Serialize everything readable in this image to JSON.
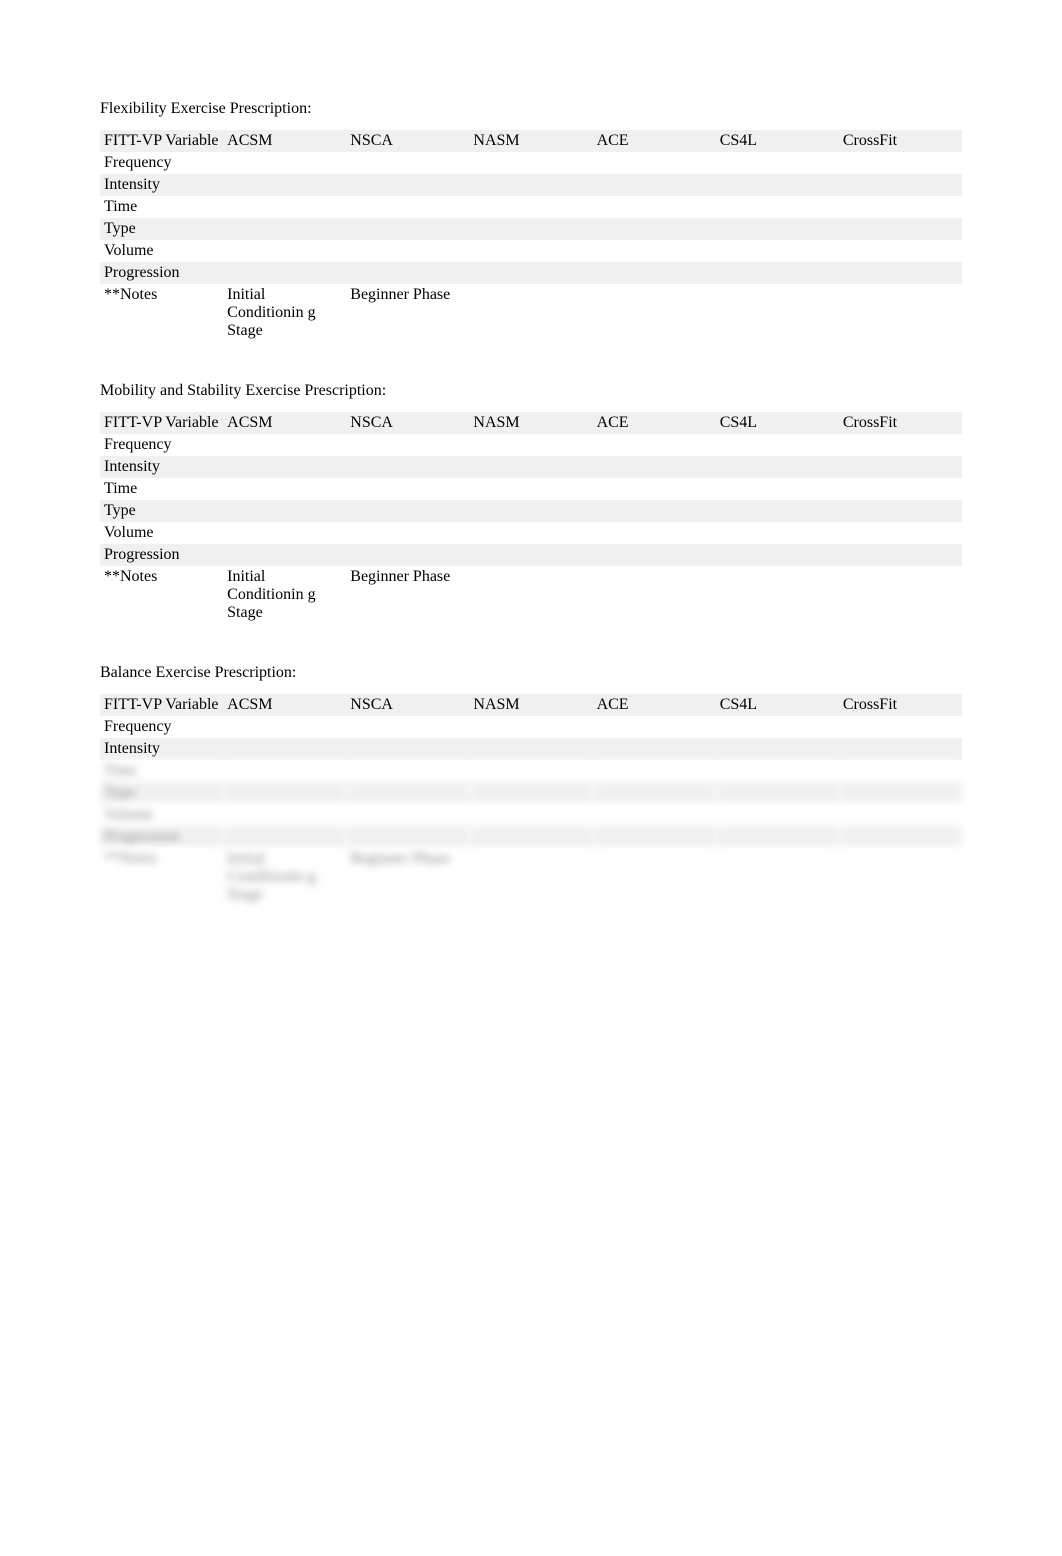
{
  "sections": [
    {
      "title": "Flexibility Exercise Prescription:",
      "columns": [
        "FITT-VP Variable",
        "ACSM",
        "NSCA",
        "NASM",
        "ACE",
        "CS4L",
        "CrossFit"
      ],
      "rows": [
        {
          "label": "Frequency",
          "values": [
            "",
            "",
            "",
            "",
            "",
            ""
          ]
        },
        {
          "label": "Intensity",
          "values": [
            "",
            "",
            "",
            "",
            "",
            ""
          ]
        },
        {
          "label": "Time",
          "values": [
            "",
            "",
            "",
            "",
            "",
            ""
          ]
        },
        {
          "label": "Type",
          "values": [
            "",
            "",
            "",
            "",
            "",
            ""
          ]
        },
        {
          "label": "Volume",
          "values": [
            "",
            "",
            "",
            "",
            "",
            ""
          ]
        },
        {
          "label": "Progression",
          "values": [
            "",
            "",
            "",
            "",
            "",
            ""
          ]
        },
        {
          "label": "**Notes",
          "values": [
            "Initial Conditionin g Stage",
            "Beginner Phase",
            "",
            "",
            "",
            ""
          ]
        }
      ],
      "blurred": false
    },
    {
      "title": "Mobility and Stability Exercise Prescription:",
      "columns": [
        "FITT-VP Variable",
        "ACSM",
        "NSCA",
        "NASM",
        "ACE",
        "CS4L",
        "CrossFit"
      ],
      "rows": [
        {
          "label": "Frequency",
          "values": [
            "",
            "",
            "",
            "",
            "",
            ""
          ]
        },
        {
          "label": "Intensity",
          "values": [
            "",
            "",
            "",
            "",
            "",
            ""
          ]
        },
        {
          "label": "Time",
          "values": [
            "",
            "",
            "",
            "",
            "",
            ""
          ]
        },
        {
          "label": "Type",
          "values": [
            "",
            "",
            "",
            "",
            "",
            ""
          ]
        },
        {
          "label": "Volume",
          "values": [
            "",
            "",
            "",
            "",
            "",
            ""
          ]
        },
        {
          "label": "Progression",
          "values": [
            "",
            "",
            "",
            "",
            "",
            ""
          ]
        },
        {
          "label": "**Notes",
          "values": [
            "Initial Conditionin g Stage",
            "Beginner Phase",
            "",
            "",
            "",
            ""
          ]
        }
      ],
      "blurred": false
    },
    {
      "title": "Balance Exercise Prescription:",
      "columns": [
        "FITT-VP Variable",
        "ACSM",
        "NSCA",
        "NASM",
        "ACE",
        "CS4L",
        "CrossFit"
      ],
      "rows": [
        {
          "label": "Frequency",
          "values": [
            "",
            "",
            "",
            "",
            "",
            ""
          ]
        },
        {
          "label": "Intensity",
          "values": [
            "",
            "",
            "",
            "",
            "",
            ""
          ]
        },
        {
          "label": "Time",
          "values": [
            "",
            "",
            "",
            "",
            "",
            ""
          ],
          "blurred": true
        },
        {
          "label": "Type",
          "values": [
            "",
            "",
            "",
            "",
            "",
            ""
          ],
          "blurred": true
        },
        {
          "label": "Volume",
          "values": [
            "",
            "",
            "",
            "",
            "",
            ""
          ],
          "blurred": true
        },
        {
          "label": "Progression",
          "values": [
            "",
            "",
            "",
            "",
            "",
            ""
          ],
          "blurred": true
        },
        {
          "label": "**Notes",
          "values": [
            "Initial Conditionin g Stage",
            "Beginner Phase",
            "",
            "",
            "",
            ""
          ],
          "blurred": true
        }
      ],
      "blurred": false
    }
  ]
}
